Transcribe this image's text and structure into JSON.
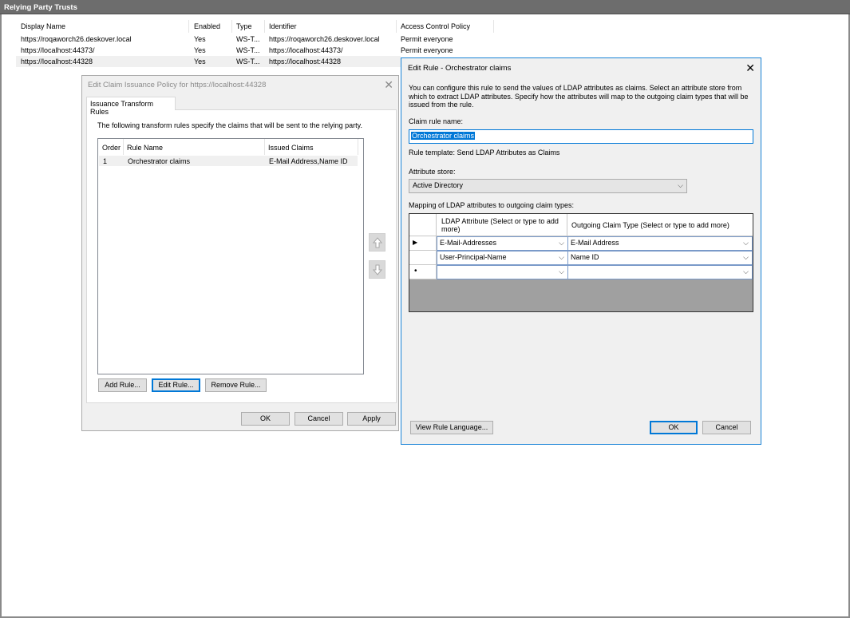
{
  "main": {
    "title": "Relying Party Trusts",
    "columns": [
      "Display Name",
      "Enabled",
      "Type",
      "Identifier",
      "Access Control Policy"
    ],
    "rows": [
      [
        "https://roqaworch26.deskover.local",
        "Yes",
        "WS-T...",
        "https://roqaworch26.deskover.local",
        "Permit everyone"
      ],
      [
        "https://localhost:44373/",
        "Yes",
        "WS-T...",
        "https://localhost:44373/",
        "Permit everyone"
      ],
      [
        "https://localhost:44328",
        "Yes",
        "WS-T...",
        "https://localhost:44328",
        ""
      ]
    ]
  },
  "policy_dialog": {
    "title": "Edit Claim Issuance Policy for https://localhost:44328",
    "tab": "Issuance Transform Rules",
    "intro": "The following transform rules specify the claims that will be sent to the relying party.",
    "columns": [
      "Order",
      "Rule Name",
      "Issued Claims"
    ],
    "rules": [
      [
        "1",
        "Orchestrator claims",
        "E-Mail Address,Name ID"
      ]
    ],
    "add_rule": "Add Rule...",
    "edit_rule": "Edit Rule...",
    "remove_rule": "Remove Rule...",
    "ok": "OK",
    "cancel": "Cancel",
    "apply": "Apply"
  },
  "rule_dialog": {
    "title": "Edit Rule - Orchestrator claims",
    "description": "You can configure this rule to send the values of LDAP attributes as claims. Select an attribute store from which to extract LDAP attributes. Specify how the attributes will map to the outgoing claim types that will be issued from the rule.",
    "claim_rule_name_label": "Claim rule name:",
    "claim_rule_name": "Orchestrator claims",
    "rule_template": "Rule template: Send LDAP Attributes as Claims",
    "attribute_store_label": "Attribute store:",
    "attribute_store": "Active Directory",
    "mapping_label": "Mapping of LDAP attributes to outgoing claim types:",
    "col_ldap": "LDAP Attribute (Select or type to add more)",
    "col_outgoing": "Outgoing Claim Type (Select or type to add more)",
    "mappings": [
      {
        "ldap": "E-Mail-Addresses",
        "outgoing": "E-Mail Address"
      },
      {
        "ldap": "User-Principal-Name",
        "outgoing": "Name ID"
      },
      {
        "ldap": "",
        "outgoing": ""
      }
    ],
    "view_rule_language": "View Rule Language...",
    "ok": "OK",
    "cancel": "Cancel"
  },
  "icons": {
    "close": "close-icon",
    "chevron": "chevron-down-icon",
    "up": "move-up-icon",
    "down": "move-down-icon"
  }
}
